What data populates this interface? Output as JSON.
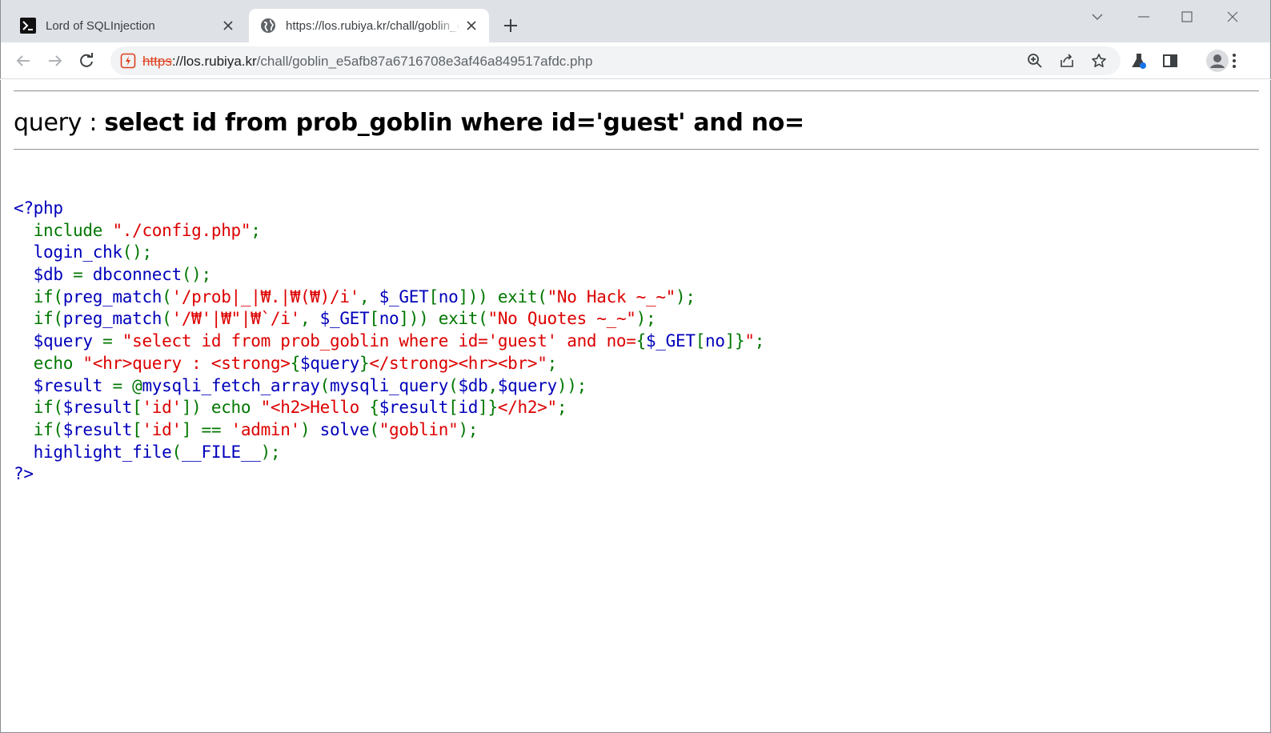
{
  "browser": {
    "tabs": [
      {
        "title": "Lord of SQLInjection",
        "favicon": "terminal-icon",
        "active": false
      },
      {
        "title": "https://los.rubiya.kr/chall/goblin_e5afb87a6716708e3af46a849517afdc.php",
        "favicon": "globe-icon",
        "active": true
      }
    ],
    "address": {
      "scheme": "https",
      "separator": "://",
      "host": "los.rubiya.kr",
      "path": "/chall/goblin_e5afb87a6716708e3af46a849517afdc.php"
    },
    "colors": {
      "tabstrip": "#dee1e6",
      "omnibox": "#f1f3f4",
      "insecure_scheme": "#e0401f"
    }
  },
  "page": {
    "query_prefix": "query : ",
    "query_strong": "select id from prob_goblin where id='guest' and no="
  },
  "code_colors": {
    "default": "#0000bb",
    "keyword": "#007700",
    "string": "#dd0000"
  },
  "code_lines": [
    [
      {
        "t": "<?php",
        "c": "def"
      }
    ],
    [
      {
        "t": "  ",
        "c": "def"
      },
      {
        "t": "include ",
        "c": "kw"
      },
      {
        "t": "\"./config.php\"",
        "c": "str"
      },
      {
        "t": ";",
        "c": "kw"
      }
    ],
    [
      {
        "t": "  login_chk",
        "c": "def"
      },
      {
        "t": "();",
        "c": "kw"
      }
    ],
    [
      {
        "t": "  $db ",
        "c": "def"
      },
      {
        "t": "= ",
        "c": "kw"
      },
      {
        "t": "dbconnect",
        "c": "def"
      },
      {
        "t": "();",
        "c": "kw"
      }
    ],
    [
      {
        "t": "  ",
        "c": "def"
      },
      {
        "t": "if(",
        "c": "kw"
      },
      {
        "t": "preg_match",
        "c": "def"
      },
      {
        "t": "(",
        "c": "kw"
      },
      {
        "t": "'/prob|_|₩.|₩(₩)/i'",
        "c": "str"
      },
      {
        "t": ", ",
        "c": "kw"
      },
      {
        "t": "$_GET",
        "c": "def"
      },
      {
        "t": "[",
        "c": "kw"
      },
      {
        "t": "no",
        "c": "def"
      },
      {
        "t": "])) exit(",
        "c": "kw"
      },
      {
        "t": "\"No Hack ~_~\"",
        "c": "str"
      },
      {
        "t": ");",
        "c": "kw"
      }
    ],
    [
      {
        "t": "  ",
        "c": "def"
      },
      {
        "t": "if(",
        "c": "kw"
      },
      {
        "t": "preg_match",
        "c": "def"
      },
      {
        "t": "(",
        "c": "kw"
      },
      {
        "t": "'/₩'|₩\"|₩`/i'",
        "c": "str"
      },
      {
        "t": ", ",
        "c": "kw"
      },
      {
        "t": "$_GET",
        "c": "def"
      },
      {
        "t": "[",
        "c": "kw"
      },
      {
        "t": "no",
        "c": "def"
      },
      {
        "t": "])) exit(",
        "c": "kw"
      },
      {
        "t": "\"No Quotes ~_~\"",
        "c": "str"
      },
      {
        "t": ");",
        "c": "kw"
      }
    ],
    [
      {
        "t": "  $query ",
        "c": "def"
      },
      {
        "t": "= ",
        "c": "kw"
      },
      {
        "t": "\"select id from prob_goblin where id='guest' and no=",
        "c": "str"
      },
      {
        "t": "{",
        "c": "kw"
      },
      {
        "t": "$_GET",
        "c": "def"
      },
      {
        "t": "[",
        "c": "kw"
      },
      {
        "t": "no",
        "c": "def"
      },
      {
        "t": "]}",
        "c": "kw"
      },
      {
        "t": "\"",
        "c": "str"
      },
      {
        "t": ";",
        "c": "kw"
      }
    ],
    [
      {
        "t": "  ",
        "c": "def"
      },
      {
        "t": "echo ",
        "c": "kw"
      },
      {
        "t": "\"<hr>query : <strong>",
        "c": "str"
      },
      {
        "t": "{",
        "c": "kw"
      },
      {
        "t": "$query",
        "c": "def"
      },
      {
        "t": "}",
        "c": "kw"
      },
      {
        "t": "</strong><hr><br>\"",
        "c": "str"
      },
      {
        "t": ";",
        "c": "kw"
      }
    ],
    [
      {
        "t": "  $result ",
        "c": "def"
      },
      {
        "t": "= @",
        "c": "kw"
      },
      {
        "t": "mysqli_fetch_array",
        "c": "def"
      },
      {
        "t": "(",
        "c": "kw"
      },
      {
        "t": "mysqli_query",
        "c": "def"
      },
      {
        "t": "(",
        "c": "kw"
      },
      {
        "t": "$db",
        "c": "def"
      },
      {
        "t": ",",
        "c": "kw"
      },
      {
        "t": "$query",
        "c": "def"
      },
      {
        "t": "));",
        "c": "kw"
      }
    ],
    [
      {
        "t": "  ",
        "c": "def"
      },
      {
        "t": "if(",
        "c": "kw"
      },
      {
        "t": "$result",
        "c": "def"
      },
      {
        "t": "[",
        "c": "kw"
      },
      {
        "t": "'id'",
        "c": "str"
      },
      {
        "t": "]) echo ",
        "c": "kw"
      },
      {
        "t": "\"<h2>Hello ",
        "c": "str"
      },
      {
        "t": "{",
        "c": "kw"
      },
      {
        "t": "$result",
        "c": "def"
      },
      {
        "t": "[",
        "c": "kw"
      },
      {
        "t": "id",
        "c": "def"
      },
      {
        "t": "]}",
        "c": "kw"
      },
      {
        "t": "</h2>\"",
        "c": "str"
      },
      {
        "t": ";",
        "c": "kw"
      }
    ],
    [
      {
        "t": "  ",
        "c": "def"
      },
      {
        "t": "if(",
        "c": "kw"
      },
      {
        "t": "$result",
        "c": "def"
      },
      {
        "t": "[",
        "c": "kw"
      },
      {
        "t": "'id'",
        "c": "str"
      },
      {
        "t": "] == ",
        "c": "kw"
      },
      {
        "t": "'admin'",
        "c": "str"
      },
      {
        "t": ") ",
        "c": "kw"
      },
      {
        "t": "solve",
        "c": "def"
      },
      {
        "t": "(",
        "c": "kw"
      },
      {
        "t": "\"goblin\"",
        "c": "str"
      },
      {
        "t": ");",
        "c": "kw"
      }
    ],
    [
      {
        "t": "  highlight_file",
        "c": "def"
      },
      {
        "t": "(",
        "c": "kw"
      },
      {
        "t": "__FILE__",
        "c": "def"
      },
      {
        "t": ");",
        "c": "kw"
      }
    ],
    [
      {
        "t": "?>",
        "c": "def"
      }
    ]
  ]
}
